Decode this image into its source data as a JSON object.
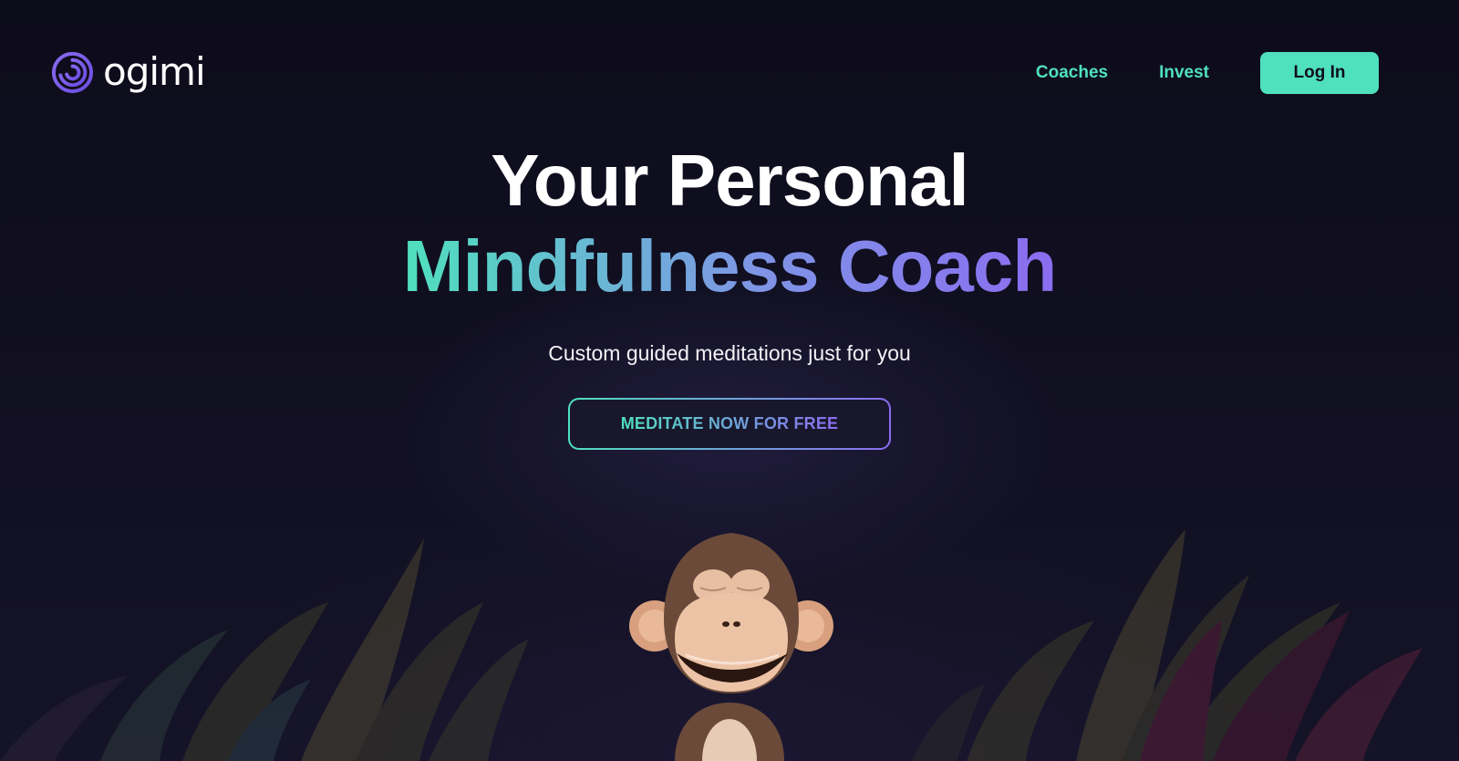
{
  "header": {
    "logo_text": "ogimi",
    "nav": [
      {
        "label": "Coaches"
      },
      {
        "label": "Invest"
      }
    ],
    "login_label": "Log In"
  },
  "hero": {
    "title_line1": "Your Personal",
    "title_line2": "Mindfulness Coach",
    "subtitle": "Custom guided meditations just for you",
    "cta_label": "MEDITATE NOW FOR FREE"
  },
  "illustration": {
    "subject": "meditating-monkey",
    "foliage": "jungle-plants"
  },
  "colors": {
    "background": "#0f0e1d",
    "accent_teal": "#4fe0be",
    "accent_purple": "#8b6cf0",
    "monkey_brown": "#6b4a3a",
    "monkey_face": "#e8b99a"
  }
}
